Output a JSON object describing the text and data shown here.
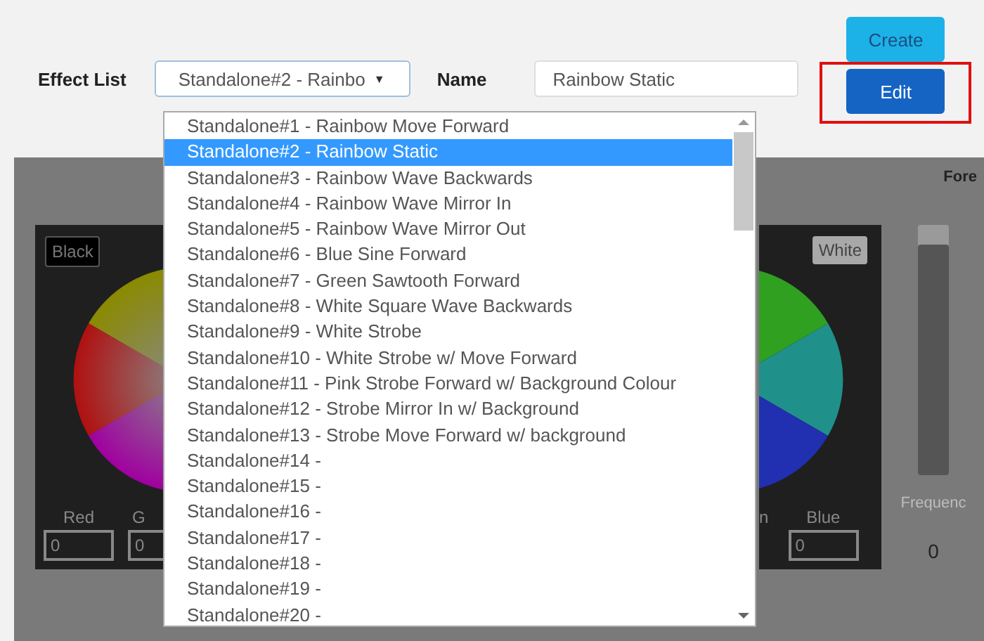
{
  "toolbar": {
    "effect_list_label": "Effect List",
    "select_value": "Standalone#2 - Rainbo",
    "select_arrow": "▼",
    "name_label": "Name",
    "name_value": "Rainbow Static",
    "create_button": "Create",
    "edit_button": "Edit",
    "edit_highlighted": true
  },
  "dropdown": {
    "options": [
      {
        "label": "Standalone#1 - Rainbow Move Forward",
        "selected": false
      },
      {
        "label": "Standalone#2 - Rainbow Static",
        "selected": true
      },
      {
        "label": "Standalone#3 - Rainbow Wave Backwards",
        "selected": false
      },
      {
        "label": "Standalone#4 - Rainbow Wave Mirror In",
        "selected": false
      },
      {
        "label": "Standalone#5 - Rainbow Wave Mirror Out",
        "selected": false
      },
      {
        "label": "Standalone#6 - Blue Sine Forward",
        "selected": false
      },
      {
        "label": "Standalone#7 - Green Sawtooth Forward",
        "selected": false
      },
      {
        "label": "Standalone#8 - White Square Wave Backwards",
        "selected": false
      },
      {
        "label": "Standalone#9 - White Strobe",
        "selected": false
      },
      {
        "label": "Standalone#10 - White Strobe w/ Move Forward",
        "selected": false
      },
      {
        "label": "Standalone#11 - Pink Strobe Forward w/ Background Colour",
        "selected": false
      },
      {
        "label": "Standalone#12 - Strobe Mirror In w/ Background",
        "selected": false
      },
      {
        "label": "Standalone#13 - Strobe Move Forward w/ background",
        "selected": false
      },
      {
        "label": "Standalone#14 -",
        "selected": false
      },
      {
        "label": "Standalone#15 -",
        "selected": false
      },
      {
        "label": "Standalone#16 -",
        "selected": false
      },
      {
        "label": "Standalone#17 -",
        "selected": false
      },
      {
        "label": "Standalone#18 -",
        "selected": false
      },
      {
        "label": "Standalone#19 -",
        "selected": false
      },
      {
        "label": "Standalone#20 -",
        "selected": false
      }
    ]
  },
  "left_picker": {
    "button": "Black",
    "fields": [
      {
        "label": "Red",
        "value": "0"
      },
      {
        "label": "G",
        "value": "0"
      }
    ]
  },
  "right_picker": {
    "button": "White",
    "fields": [
      {
        "label": "n"
      },
      {
        "label": "Blue",
        "value": "0"
      }
    ]
  },
  "side": {
    "heading": "Fore",
    "slider": {
      "level": 0.92
    },
    "slider_label": "Frequenc",
    "value": "0"
  }
}
